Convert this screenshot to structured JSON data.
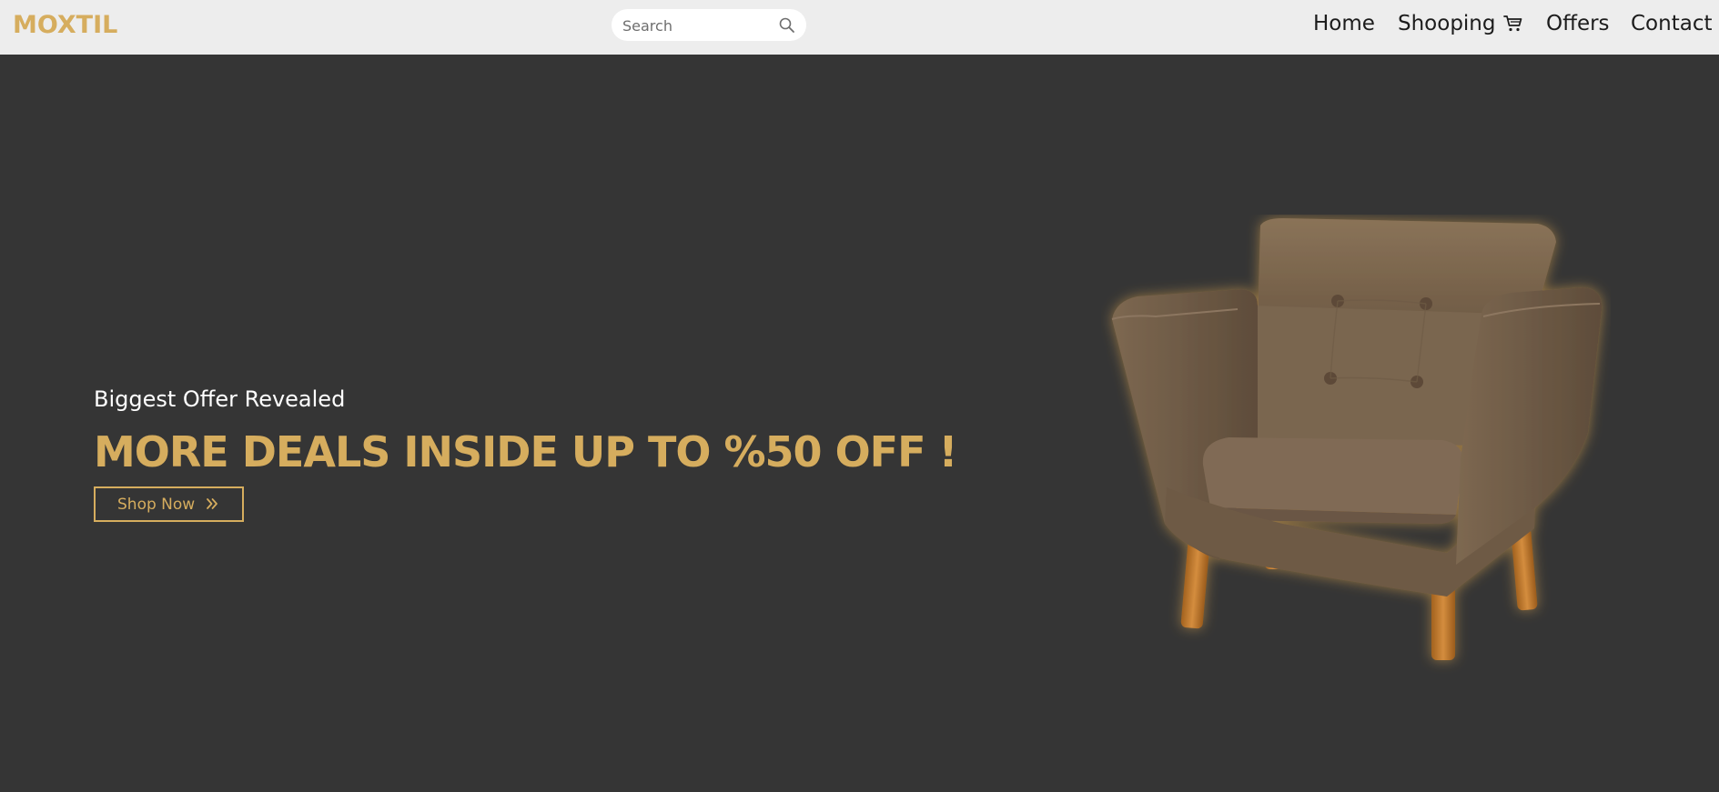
{
  "header": {
    "brand": "MOXTIL",
    "search": {
      "placeholder": "Search",
      "value": "",
      "icon": "search-icon"
    },
    "nav": {
      "home": "Home",
      "shopping": "Shooping",
      "shopping_icon": "cart-icon",
      "offers": "Offers",
      "contact": "Contact"
    }
  },
  "hero": {
    "subtitle": "Biggest Offer Revealed",
    "title": "MORE DEALS INSIDE UP TO %50 OFF !",
    "button_label": "Shop Now",
    "button_icon": "double-chevron-right-icon",
    "image": "armchair-image"
  },
  "colors": {
    "accent": "#d6ad5e",
    "header_bg": "#ededed",
    "hero_bg": "#353535",
    "chair_fabric": "#7b6650",
    "chair_legs": "#c07a2c"
  }
}
